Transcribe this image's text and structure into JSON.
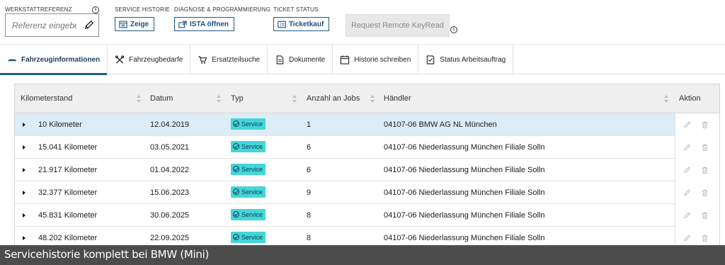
{
  "toolbar": {
    "werkstattreferenz": {
      "label": "WERKSTATTREFERENZ",
      "placeholder": "Referenz eingeben",
      "value": ""
    },
    "service_historie": {
      "label": "SERVICE HISTORIE",
      "button": "Zeige"
    },
    "diagnose": {
      "label": "DIAGNOSE & PROGRAMMIERUNG",
      "button": "ISTA öffnen"
    },
    "ticket_status": {
      "label": "TICKET STATUS",
      "button": "Ticketkauf"
    },
    "remote_button": "Request Remote KeyRead",
    "info_glyph": "i"
  },
  "tabs": [
    {
      "label": "Fahrzeuginformationen",
      "icon": "car-icon",
      "active": true
    },
    {
      "label": "Fahrzeugbedarfe",
      "icon": "tools-icon",
      "active": false
    },
    {
      "label": "Ersatzteilsuche",
      "icon": "cart-icon",
      "active": false
    },
    {
      "label": "Dokumente",
      "icon": "document-icon",
      "active": false
    },
    {
      "label": "Historie schreiben",
      "icon": "calendar-icon",
      "active": false
    },
    {
      "label": "Status Arbeitsauftrag",
      "icon": "checklist-icon",
      "active": false
    }
  ],
  "table": {
    "columns": [
      "Kilometerstand",
      "Datum",
      "Typ",
      "Anzahl an Jobs",
      "Händler",
      "Aktion"
    ],
    "rows": [
      {
        "km": "10 Kilometer",
        "datum": "12.04.2019",
        "typ": "Service",
        "jobs": "1",
        "haendler": "04107-06 BMW AG NL München",
        "selected": true
      },
      {
        "km": "15.041 Kilometer",
        "datum": "03.05.2021",
        "typ": "Service",
        "jobs": "6",
        "haendler": "04107-06 Niederlassung München Filiale Solln",
        "selected": false
      },
      {
        "km": "21.917 Kilometer",
        "datum": "01.04.2022",
        "typ": "Service",
        "jobs": "6",
        "haendler": "04107-06 Niederlassung München Filiale Solln",
        "selected": false
      },
      {
        "km": "32.377 Kilometer",
        "datum": "15.06.2023",
        "typ": "Service",
        "jobs": "9",
        "haendler": "04107-06 Niederlassung München Filiale Solln",
        "selected": false
      },
      {
        "km": "45.831 Kilometer",
        "datum": "30.06.2025",
        "typ": "Service",
        "jobs": "8",
        "haendler": "04107-06 Niederlassung München Filiale Solln",
        "selected": false
      },
      {
        "km": "48.202 Kilometer",
        "datum": "22.09.2025",
        "typ": "Service",
        "jobs": "8",
        "haendler": "04107-06 Niederlassung München Filiale Solln",
        "selected": false
      }
    ]
  },
  "caption": "Servicehistorie komplett bei BMW (Mini)",
  "colors": {
    "accent": "#1b5e8a",
    "badge": "#43d6da",
    "selected_row": "#dcedf8",
    "header_bg": "#efefef",
    "caption_bg": "#3e3e3e"
  }
}
